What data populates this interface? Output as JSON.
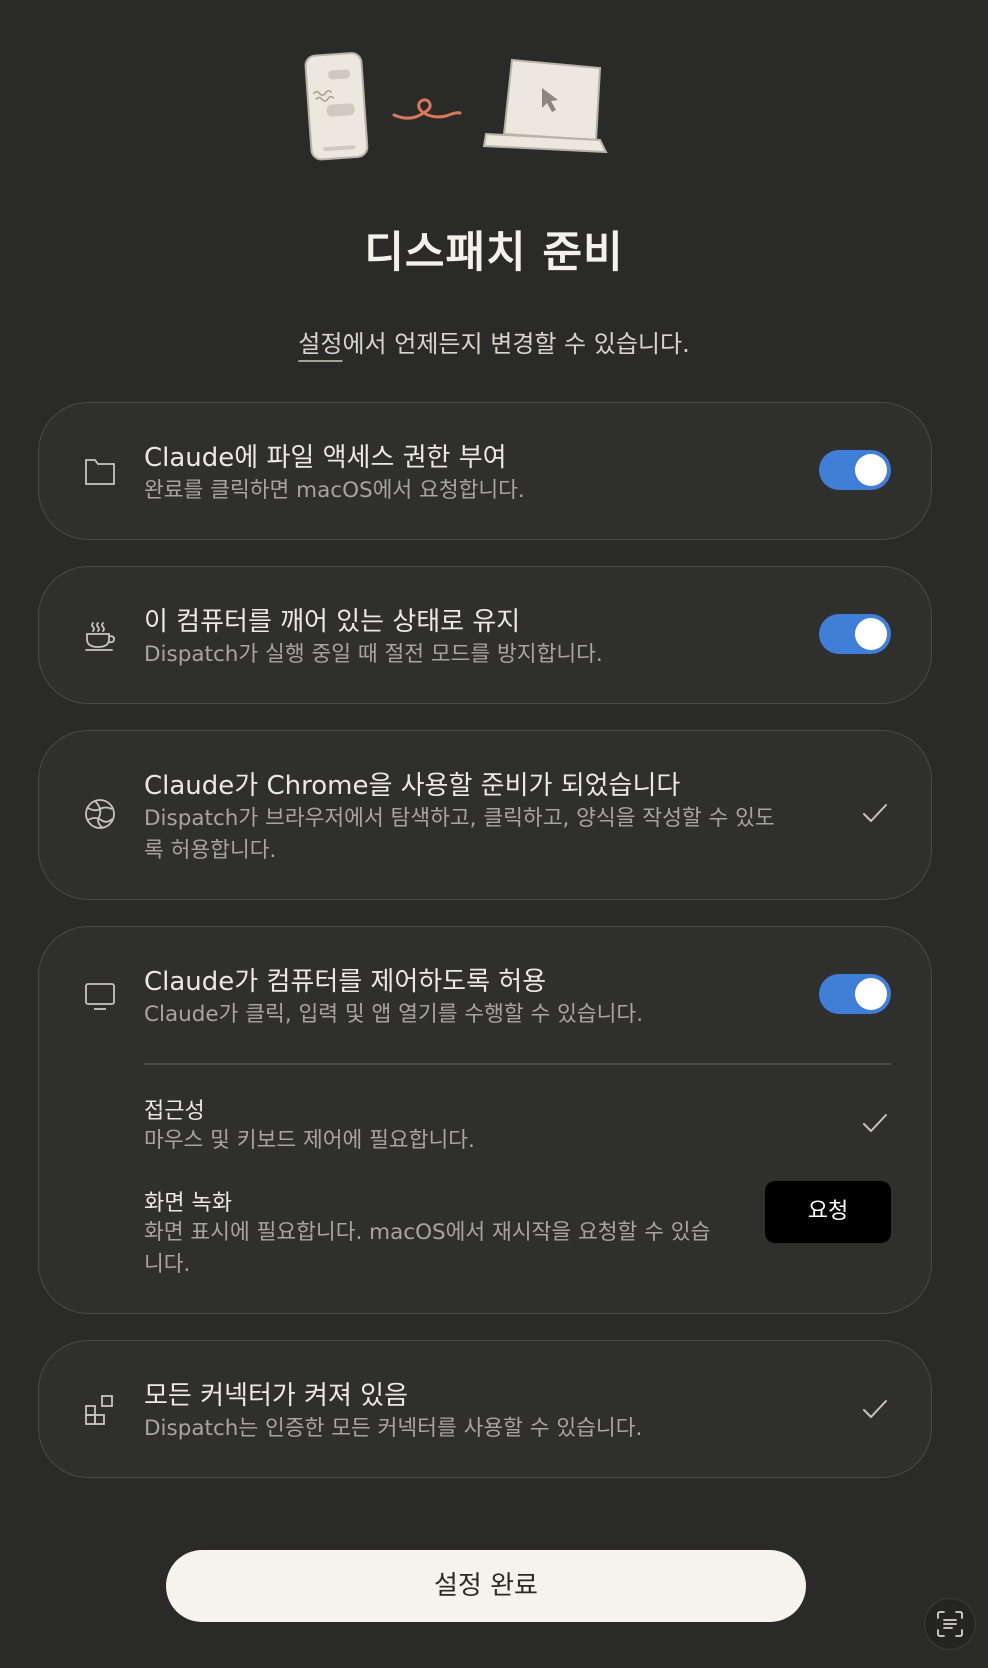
{
  "header": {
    "title": "디스패치 준비",
    "subtitle_link": "설정",
    "subtitle_rest": "에서 언제든지 변경할 수 있습니다."
  },
  "illustration": {
    "phone_icon": "phone-illustration",
    "link_icon": "squiggle-connector",
    "laptop_icon": "laptop-illustration"
  },
  "items": [
    {
      "icon": "folder-icon",
      "title": "Claude에 파일 액세스 권한 부여",
      "description": "완료를 클릭하면 macOS에서 요청합니다.",
      "control": "toggle",
      "enabled": true
    },
    {
      "icon": "coffee-cup-icon",
      "title": "이 컴퓨터를 깨어 있는 상태로 유지",
      "description": "Dispatch가 실행 중일 때 절전 모드를 방지합니다.",
      "control": "toggle",
      "enabled": true
    },
    {
      "icon": "globe-icon",
      "title": "Claude가 Chrome을 사용할 준비가 되었습니다",
      "description_line1": "Dispatch가 브라우저에서 탐색하고, 클릭하고, 양식을 작성할 수 있도",
      "description_line2": "록 허용합니다.",
      "control": "check"
    },
    {
      "icon": "monitor-icon",
      "title": "Claude가 컴퓨터를 제어하도록 허용",
      "description": "Claude가 클릭, 입력 및 앱 열기를 수행할 수 있습니다.",
      "control": "toggle",
      "enabled": true,
      "sub_items": [
        {
          "title": "접근성",
          "description": "마우스 및 키보드 제어에 필요합니다.",
          "control": "check"
        },
        {
          "title": "화면 녹화",
          "description_line1": "화면 표시에 필요합니다. macOS에서 재시작을 요청할 수 있습",
          "description_line2": "니다.",
          "control": "button",
          "button_label": "요청"
        }
      ]
    },
    {
      "icon": "connectors-icon",
      "title": "모든 커넥터가 켜져 있음",
      "description": "Dispatch는 인증한 모든 커넥터를 사용할 수 있습니다.",
      "control": "check"
    }
  ],
  "footer": {
    "done_label": "설정 완료",
    "scan_icon": "text-scan-icon"
  },
  "colors": {
    "background": "#2a2a28",
    "card": "#2f2f2d",
    "toggle_on": "#3f7fd8",
    "accent_squiggle": "#d9785a"
  }
}
